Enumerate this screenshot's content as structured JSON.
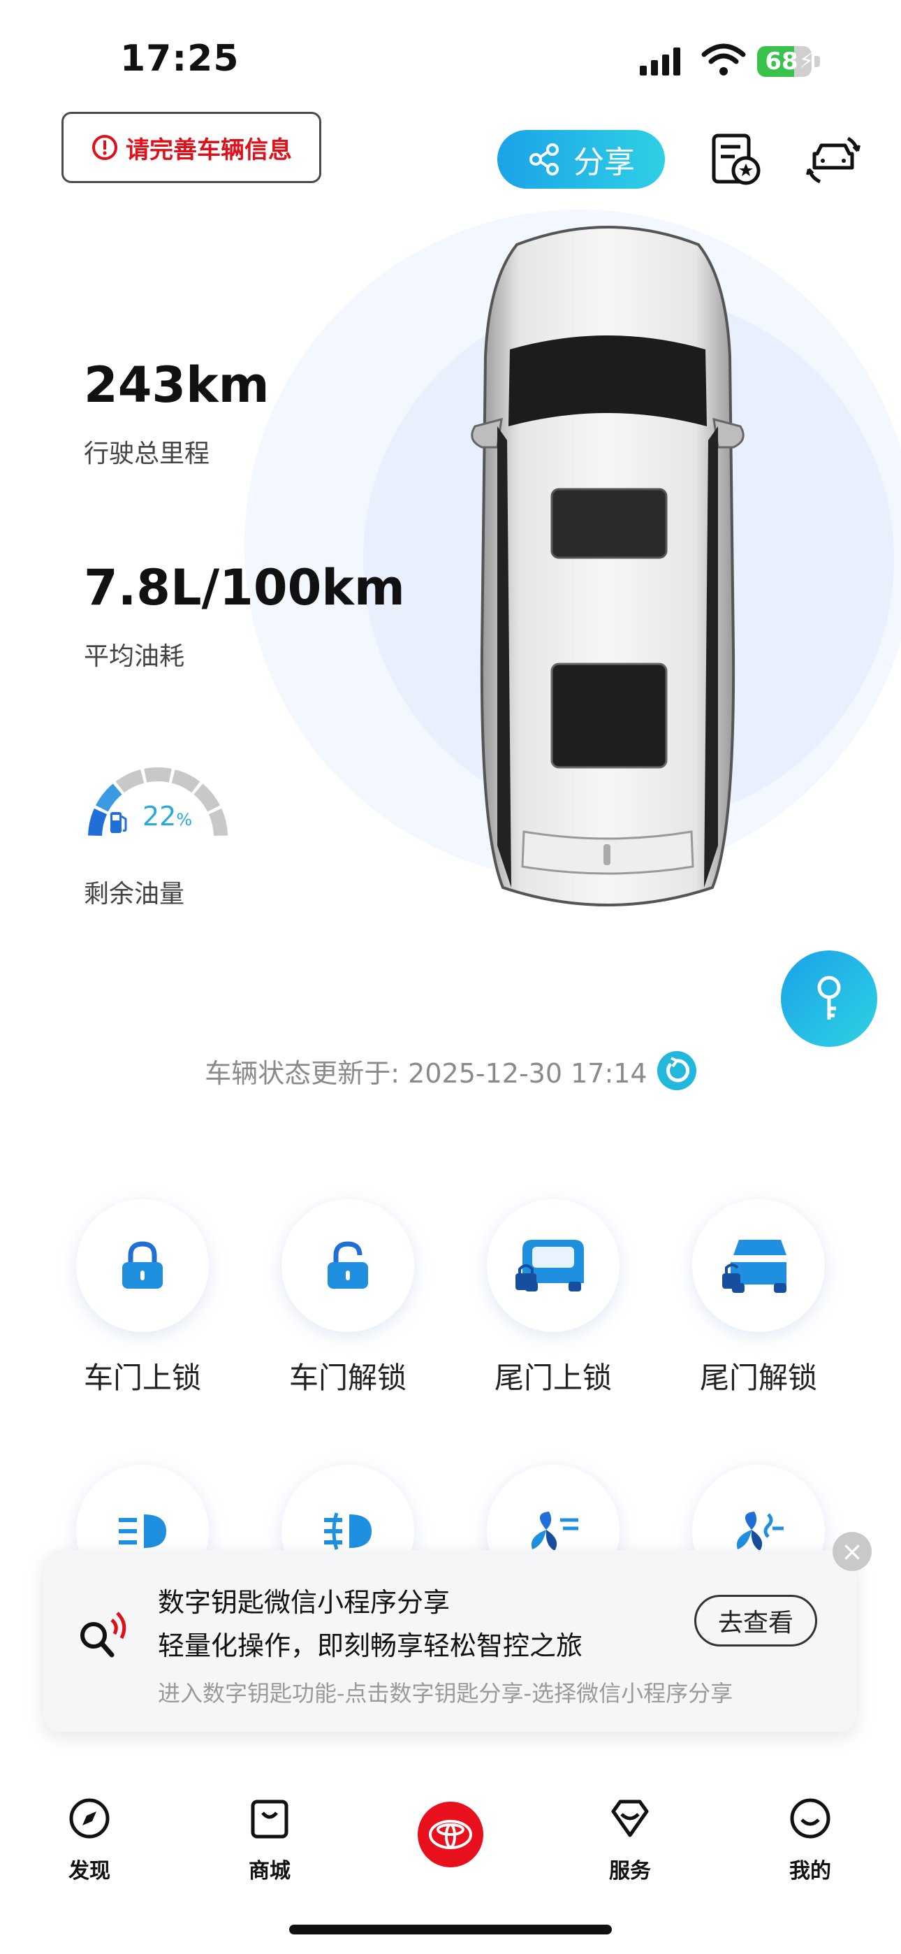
{
  "status_bar": {
    "time": "17:25",
    "battery": "68",
    "battery_level": 0.68
  },
  "top_bar": {
    "complete_info_label": "请完善车辆信息",
    "share_label": "分享"
  },
  "stats": {
    "mileage_value": "243km",
    "mileage_label": "行驶总里程",
    "fuel_economy_value": "7.8L/100km",
    "fuel_economy_label": "平均油耗",
    "fuel_percent_value": "22",
    "fuel_percent_unit": "%",
    "fuel_level_label": "剩余油量",
    "fuel_level": 0.22
  },
  "vehicle_status": {
    "text": "车辆状态更新于: 2025-12-30 17:14"
  },
  "controls": [
    {
      "label": "车门上锁",
      "icon": "lock-icon"
    },
    {
      "label": "车门解锁",
      "icon": "unlock-icon"
    },
    {
      "label": "尾门上锁",
      "icon": "tailgate-lock-icon"
    },
    {
      "label": "尾门解锁",
      "icon": "tailgate-unlock-icon"
    },
    {
      "label": "",
      "icon": "low-beam-icon"
    },
    {
      "label": "",
      "icon": "fog-light-icon"
    },
    {
      "label": "",
      "icon": "fan-icon"
    },
    {
      "label": "",
      "icon": "fan-defrost-icon"
    }
  ],
  "promo": {
    "title": "数字钥匙微信小程序分享",
    "subtitle": "轻量化操作，即刻畅享轻松智控之旅",
    "hint": "进入数字钥匙功能-点击数字钥匙分享-选择微信小程序分享",
    "button_label": "去查看",
    "close_symbol": "×"
  },
  "tab_bar": {
    "tabs": [
      {
        "label": "发现",
        "icon": "compass-icon"
      },
      {
        "label": "商城",
        "icon": "shopping-bag-icon"
      },
      {
        "label": "",
        "icon": "toyota-logo-icon"
      },
      {
        "label": "服务",
        "icon": "diamond-icon"
      },
      {
        "label": "我的",
        "icon": "smiley-icon"
      }
    ]
  },
  "colors": {
    "accent": "#1aa3e8",
    "accent_2": "#2fd0e4",
    "warning": "#e0101a",
    "brand": "#e8101c"
  }
}
